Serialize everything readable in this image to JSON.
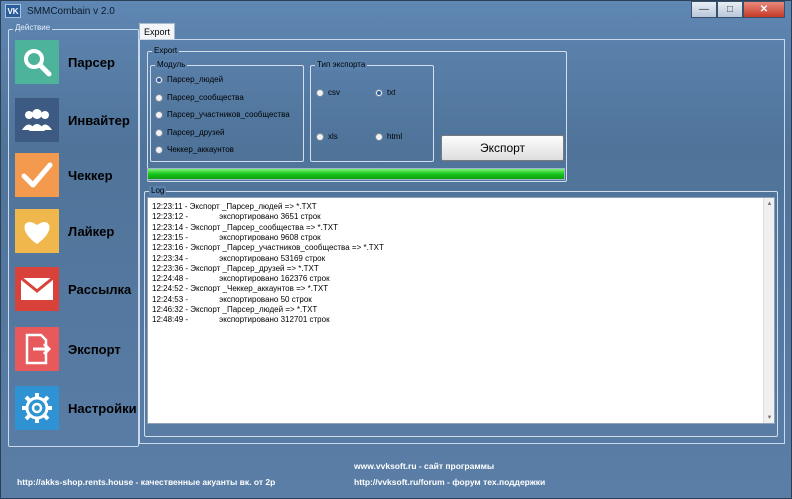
{
  "window": {
    "app_icon": "VK",
    "title": "SMMCombain v 2.0"
  },
  "window_controls": {
    "minimize": "—",
    "maximize": "□",
    "close": "✕"
  },
  "sidebar": {
    "legend": "Действие",
    "items": [
      {
        "label": "Парсер",
        "icon": "search-icon",
        "color": "#4db39a"
      },
      {
        "label": "Инвайтер",
        "icon": "users-icon",
        "color": "#3d5a82"
      },
      {
        "label": "Чеккер",
        "icon": "check-icon",
        "color": "#f49a4e"
      },
      {
        "label": "Лайкер",
        "icon": "heart-icon",
        "color": "#f0b74d"
      },
      {
        "label": "Рассылка",
        "icon": "mail-icon",
        "color": "#d8423b"
      },
      {
        "label": "Экспорт",
        "icon": "export-icon",
        "color": "#e7595a"
      },
      {
        "label": "Настройки",
        "icon": "gear-icon",
        "color": "#2f93d3"
      }
    ]
  },
  "tab": {
    "label": "Export"
  },
  "export_group": {
    "legend": "Export",
    "module_legend": "Модуль",
    "modules": [
      {
        "label": "Парсер_людей",
        "checked": true
      },
      {
        "label": "Парсер_сообщества",
        "checked": false
      },
      {
        "label": "Парсер_участников_сообщества",
        "checked": false
      },
      {
        "label": "Парсер_друзей",
        "checked": false
      },
      {
        "label": "Чеккер_аккаунтов",
        "checked": false
      }
    ],
    "type_legend": "Тип экспорта",
    "types": [
      {
        "label": "csv",
        "checked": false
      },
      {
        "label": "txt",
        "checked": true
      },
      {
        "label": "xls",
        "checked": false
      },
      {
        "label": "html",
        "checked": false
      }
    ],
    "export_button": "Экспорт",
    "progress": 1.0
  },
  "log": {
    "legend": "Log",
    "lines": [
      "12:23:11 - Экспорт _Парсер_людей => *.TXT",
      "12:23:12 -              экспортировано 3651 строк",
      "12:23:14 - Экспорт _Парсер_сообщества => *.TXT",
      "12:23:15 -              экспортировано 9608 строк",
      "12:23:16 - Экспорт _Парсер_участников_сообщества => *.TXT",
      "12:23:34 -              экспортировано 53169 строк",
      "12:23:36 - Экспорт _Парсер_друзей => *.TXT",
      "12:24:48 -              экспортировано 162376 строк",
      "12:24:52 - Экспорт _Чеккер_аккаунтов => *.TXT",
      "12:24:53 -              экспортировано 50 строк",
      "12:46:32 - Экспорт _Парсер_людей => *.TXT",
      "12:48:49 -              экспортировано 312701 строк"
    ]
  },
  "footer": {
    "shop_link": "http://akks-shop.rents.house - качественные акуанты вк. от 2р",
    "site_link": "www.vvksoft.ru - сайт программы",
    "forum_link": "http://vvksoft.ru/forum - форум тех.поддержки"
  }
}
